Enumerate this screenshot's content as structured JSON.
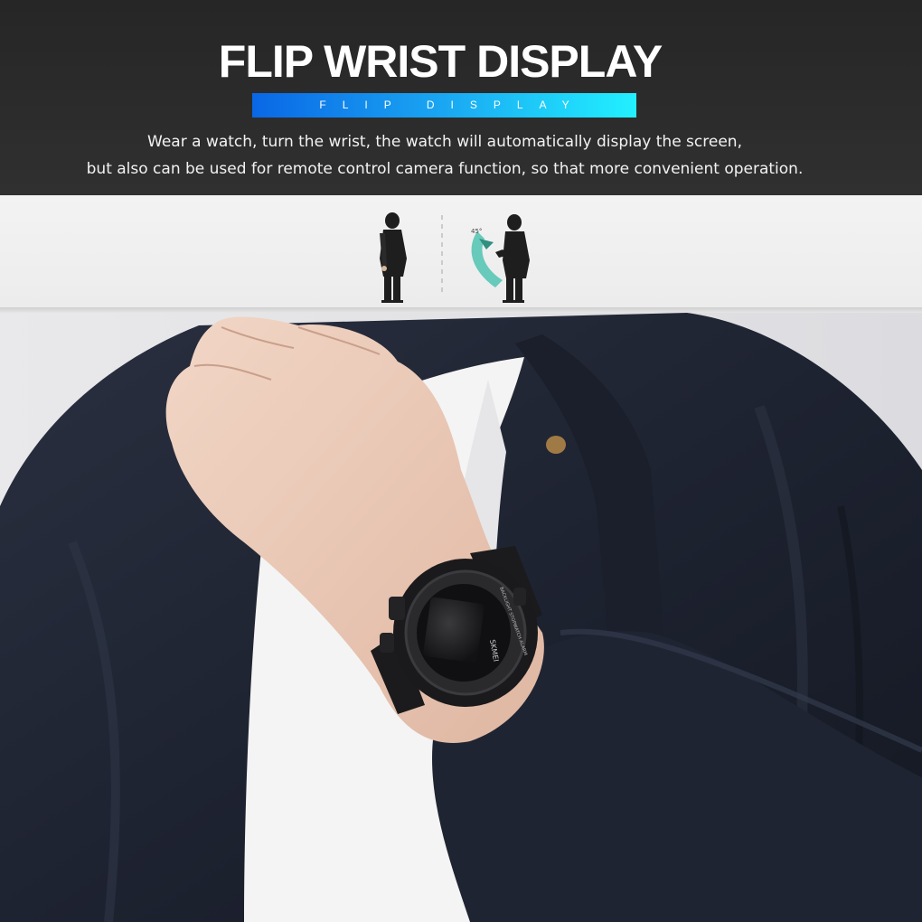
{
  "header": {
    "title": "FLIP WRIST DISPLAY",
    "subtitle": "FLIP DISPLAY",
    "description_line1": "Wear a watch, turn the wrist, the watch will automatically display the screen,",
    "description_line2": "but also can be used for remote control camera function, so that more convenient operation."
  },
  "illustration": {
    "figures": [
      "person-standing-icon",
      "person-raising-wrist-icon"
    ],
    "rotation_arrow_color": "#4fc3b0",
    "angle_label": "45°"
  },
  "photo": {
    "watch_brand": "SKMEI",
    "watch_bezel_text": "BACKLIGHT  STOPWATCH  ALARM"
  },
  "colors": {
    "header_bg": "#2b2b2b",
    "subtitle_gradient_start": "#0a67e6",
    "subtitle_gradient_end": "#22f0ff",
    "strip_bg": "#efefef"
  }
}
